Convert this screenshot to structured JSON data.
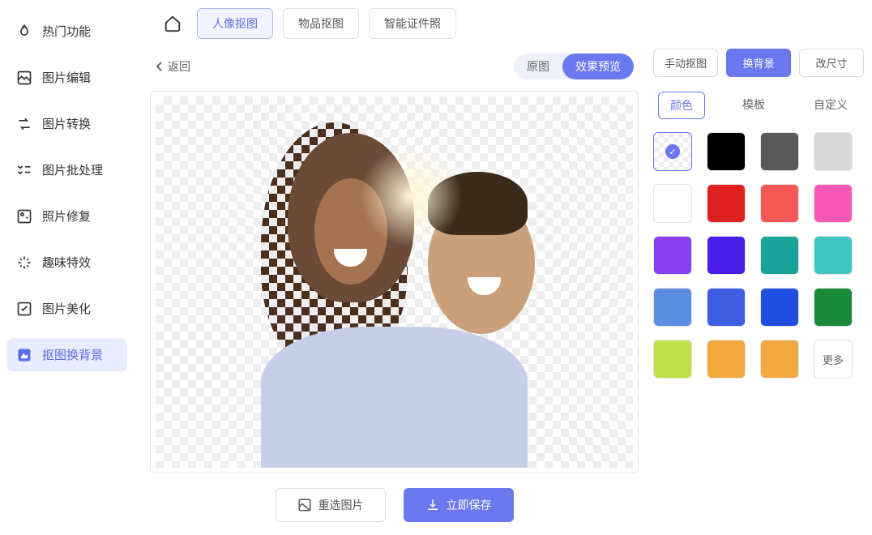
{
  "sidebar": {
    "items": [
      {
        "label": "热门功能",
        "icon": "flame-icon"
      },
      {
        "label": "图片编辑",
        "icon": "image-edit-icon"
      },
      {
        "label": "图片转换",
        "icon": "convert-icon"
      },
      {
        "label": "图片批处理",
        "icon": "batch-icon"
      },
      {
        "label": "照片修复",
        "icon": "restore-icon"
      },
      {
        "label": "趣味特效",
        "icon": "sparkle-icon"
      },
      {
        "label": "图片美化",
        "icon": "beautify-icon"
      },
      {
        "label": "抠图换背景",
        "icon": "cutout-bg-icon"
      }
    ],
    "active_index": 7
  },
  "topbar": {
    "tabs": [
      {
        "label": "人像抠图"
      },
      {
        "label": "物品抠图"
      },
      {
        "label": "智能证件照"
      }
    ],
    "active_index": 0
  },
  "back_label": "返回",
  "view_toggle": {
    "original": "原图",
    "preview": "效果预览",
    "active": "preview"
  },
  "actions": {
    "reselect": "重选图片",
    "save": "立即保存"
  },
  "right_tools": {
    "items": [
      "手动抠图",
      "换背景",
      "改尺寸"
    ],
    "active_index": 1
  },
  "bg_tabs": {
    "items": [
      "颜色",
      "模板",
      "自定义"
    ],
    "active_index": 0
  },
  "swatches": [
    {
      "type": "transparent",
      "selected": true
    },
    {
      "color": "#000000"
    },
    {
      "color": "#595959"
    },
    {
      "color": "#d9d9d9"
    },
    {
      "color": "#ffffff"
    },
    {
      "color": "#e02020"
    },
    {
      "color": "#f55656"
    },
    {
      "color": "#f756b6"
    },
    {
      "color": "#8a3ff0"
    },
    {
      "color": "#4a1de8"
    },
    {
      "color": "#1aa39a"
    },
    {
      "color": "#3fc4c4"
    },
    {
      "color": "#5a8ee0"
    },
    {
      "color": "#3f5de0"
    },
    {
      "color": "#1f4fe0"
    },
    {
      "color": "#1a8a3a"
    },
    {
      "color": "#c0e04a"
    },
    {
      "color": "#f0a83f"
    },
    {
      "color": "#f0a83f"
    }
  ],
  "more_label": "更多"
}
